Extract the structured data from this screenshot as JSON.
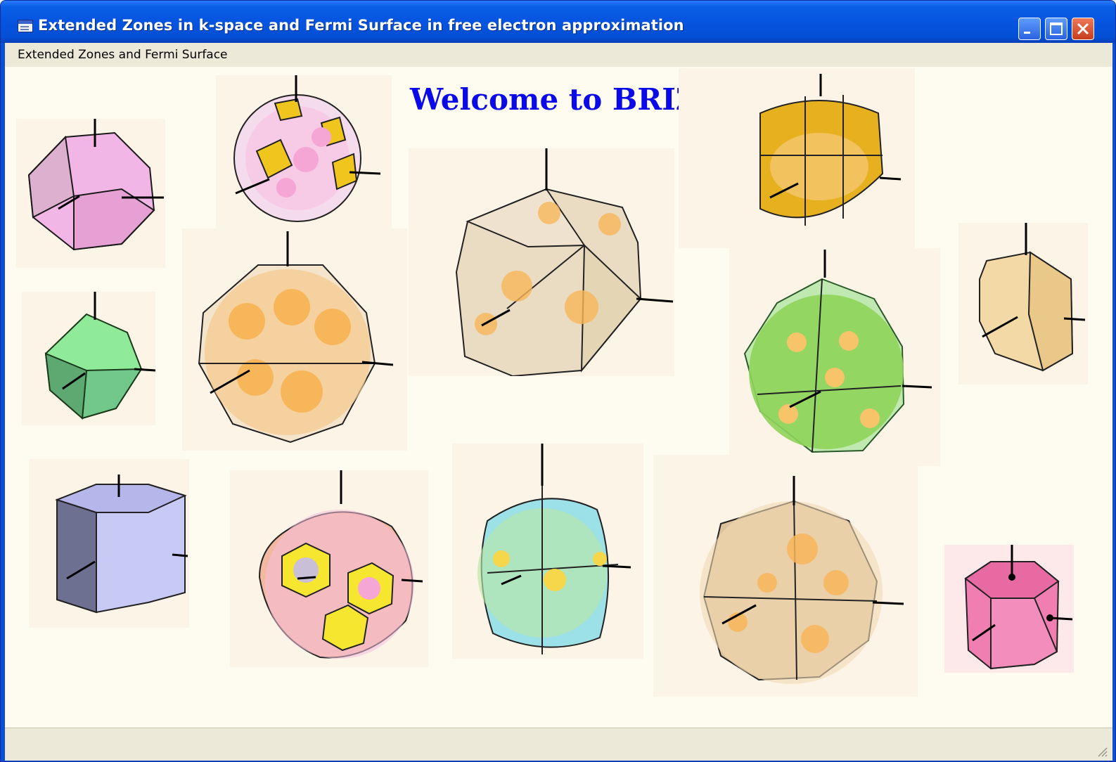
{
  "window": {
    "title": "Extended Zones in k-space  and Fermi Surface in free electron approximation"
  },
  "menu": {
    "items": [
      "Extended Zones and Fermi Surface"
    ],
    "accelerator": "E"
  },
  "main": {
    "welcome": "Welcome to BRIZ",
    "colors": {
      "welcome_text": "#0a0ae8",
      "background": "#fefbf0",
      "title_bar": "#0654e0"
    },
    "zones": [
      {
        "name": "pink-truncated-octahedron",
        "color": "#f2b6e6"
      },
      {
        "name": "pink-yellow-sphere-zone",
        "color": "#f0c61e"
      },
      {
        "name": "orange-sphere-zone",
        "color": "#f5c98c"
      },
      {
        "name": "beige-large-zone",
        "color": "#e9d6b8"
      },
      {
        "name": "gold-zone",
        "color": "#e6b01f"
      },
      {
        "name": "green-rhombic-dodecahedron",
        "color": "#8fea9a"
      },
      {
        "name": "green-sphere-zone",
        "color": "#8fd45a"
      },
      {
        "name": "beige-prism",
        "color": "#f3d9a6"
      },
      {
        "name": "blue-hexagonal-prism",
        "color": "#c8caf6"
      },
      {
        "name": "yellow-pink-zone",
        "color": "#f6e630"
      },
      {
        "name": "cyan-zone",
        "color": "#9ce0e8"
      },
      {
        "name": "tan-large-zone",
        "color": "#dcc29c"
      },
      {
        "name": "magenta-prism",
        "color": "#f07eb0"
      }
    ]
  }
}
